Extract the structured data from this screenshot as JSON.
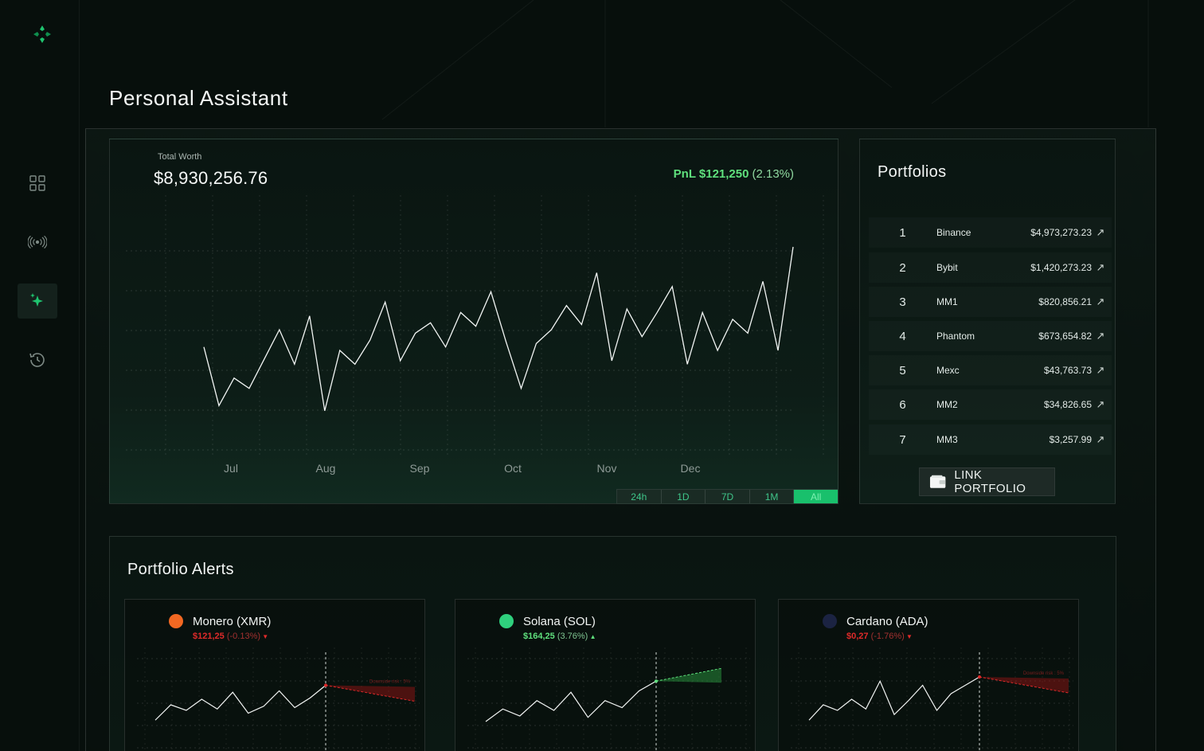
{
  "page": {
    "title": "Personal Assistant"
  },
  "sidebar": {
    "items": [
      {
        "icon": "grid-icon",
        "active": false
      },
      {
        "icon": "broadcast-icon",
        "active": false
      },
      {
        "icon": "sparkle-icon",
        "active": true
      },
      {
        "icon": "history-icon",
        "active": false
      }
    ]
  },
  "worth": {
    "label": "Total Worth",
    "value": "$8,930,256.76",
    "pnl_label": "PnL $121,250",
    "pnl_pct": "(2.13%)"
  },
  "chart_data": {
    "type": "line",
    "categories": [
      "Jul",
      "Aug",
      "Sep",
      "Oct",
      "Nov",
      "Dec"
    ],
    "y": [
      62,
      28,
      44,
      38,
      55,
      72,
      52,
      80,
      25,
      60,
      52,
      66,
      88,
      54,
      70,
      76,
      62,
      82,
      74,
      94,
      65,
      38,
      64,
      72,
      86,
      75,
      105,
      54,
      84,
      68,
      82,
      97,
      52,
      82,
      60,
      78,
      70,
      100,
      60,
      120
    ],
    "ylim": [
      0,
      150
    ],
    "accent": "#5fe07d"
  },
  "ranges": [
    "24h",
    "1D",
    "7D",
    "1M",
    "All"
  ],
  "active_range": "All",
  "portfolios": {
    "title": "Portfolios",
    "rows": [
      {
        "num": "1",
        "name": "Binance",
        "value": "$4,973,273.23"
      },
      {
        "num": "2",
        "name": "Bybit",
        "value": "$1,420,273.23"
      },
      {
        "num": "3",
        "name": "MM1",
        "value": "$820,856.21"
      },
      {
        "num": "4",
        "name": "Phantom",
        "value": "$673,654.82"
      },
      {
        "num": "5",
        "name": "Mexc",
        "value": "$43,763.73"
      },
      {
        "num": "6",
        "name": "MM2",
        "value": "$34,826.65"
      },
      {
        "num": "7",
        "name": "MM3",
        "value": "$3,257.99"
      }
    ],
    "arrow": "↗",
    "link_label": "LINK PORTFOLIO"
  },
  "alerts": {
    "title": "Portfolio Alerts",
    "cards": [
      {
        "name": "Monero (XMR)",
        "price": "$121,25",
        "change": "(-0.13%)",
        "dir": "down",
        "icon_color": "#f26822",
        "forecast_label": "Downside risk : 5%",
        "series": [
          30,
          52,
          44,
          60,
          46,
          70,
          40,
          50,
          72,
          48,
          62,
          80
        ]
      },
      {
        "name": "Solana (SOL)",
        "price": "$164,25",
        "change": "(3.76%)",
        "dir": "up",
        "icon_color": "#2fd07d",
        "forecast_label": "",
        "series": [
          28,
          46,
          36,
          58,
          44,
          70,
          34,
          58,
          48,
          72,
          86
        ]
      },
      {
        "name": "Cardano (ADA)",
        "price": "$0,27",
        "change": "(-1.76%)",
        "dir": "down",
        "icon_color": "#1b2342",
        "forecast_label": "Downside risk : 5%",
        "series": [
          30,
          52,
          44,
          60,
          46,
          86,
          38,
          58,
          80,
          44,
          68,
          80,
          92
        ]
      }
    ]
  }
}
